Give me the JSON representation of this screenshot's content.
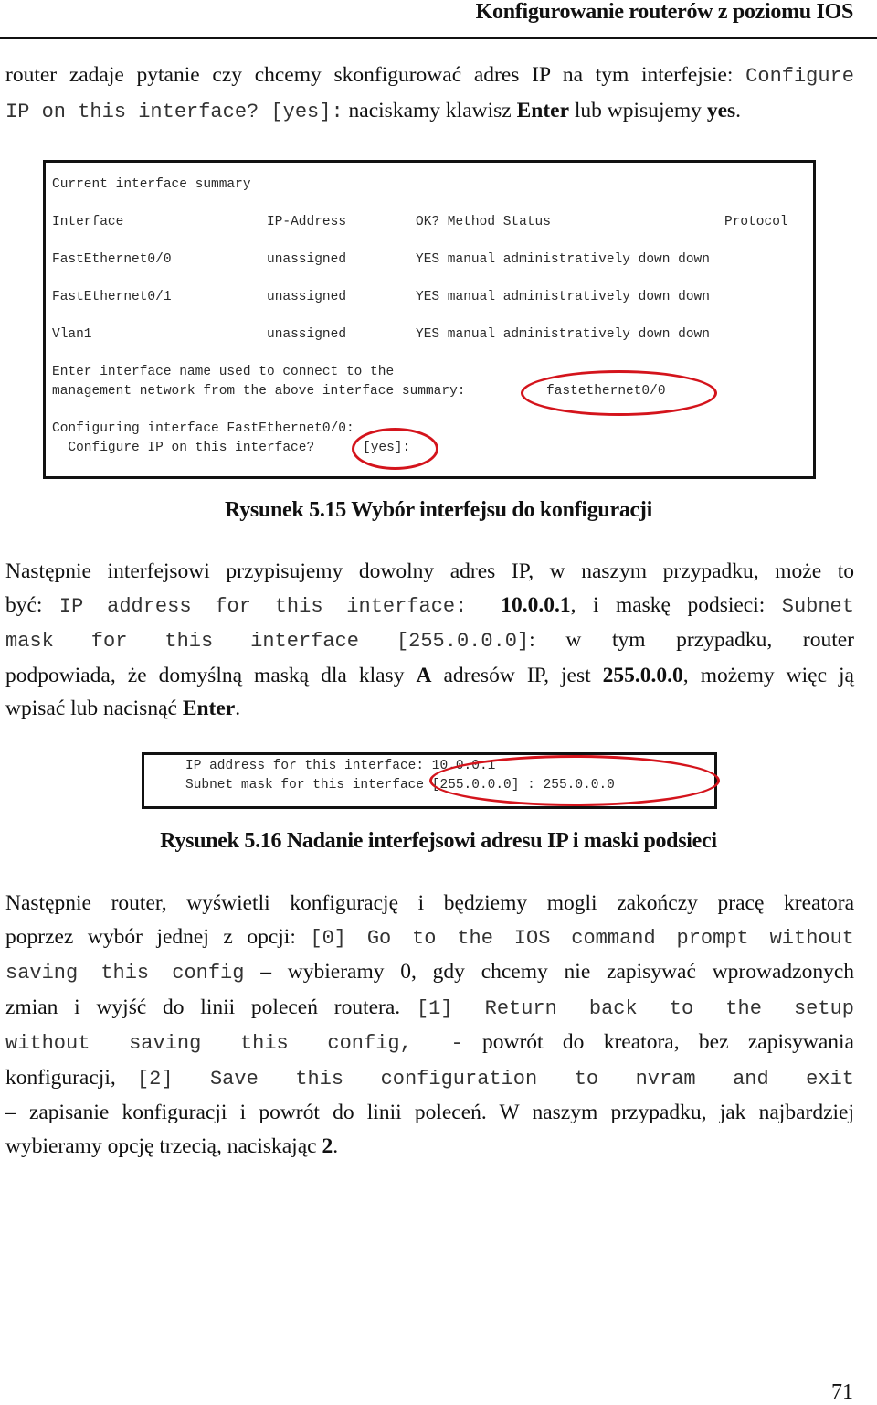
{
  "header": {
    "title": "Konfigurowanie routerów z poziomu IOS"
  },
  "para1": {
    "t1": "router zadaje pytanie czy chcemy skonfigurować adres IP na tym interfejsie: ",
    "m1": "Configure",
    "m2": "IP on this interface? [yes]:",
    "t2": " naciskamy klawisz ",
    "b1": "Enter",
    "t3": " lub wpisujemy ",
    "b2": "yes",
    "t4": "."
  },
  "figure1": {
    "lines": {
      "summary": "Current interface summary",
      "header_interface": "Interface",
      "header_ip": "IP-Address",
      "header_rest": "OK? Method Status",
      "header_protocol": "Protocol",
      "enter1": "Enter interface name used to connect to the",
      "enter2": "management network from the above interface summary:",
      "enter2_answer": "fastethernet0/0",
      "configuring": "Configuring interface FastEthernet0/0:",
      "configure_ip": "  Configure IP on this interface?",
      "configure_ip_default": "[yes]:"
    },
    "rows": [
      {
        "interface": "FastEthernet0/0",
        "ip": "unassigned",
        "rest": "YES manual administratively down down"
      },
      {
        "interface": "FastEthernet0/1",
        "ip": "unassigned",
        "rest": "YES manual administratively down down"
      },
      {
        "interface": "Vlan1",
        "ip": "unassigned",
        "rest": "YES manual administratively down down"
      }
    ],
    "caption": "Rysunek 5.15 Wybór interfejsu do konfiguracji",
    "highlight_color": "#d4141c"
  },
  "para2": {
    "t1": "Następnie interfejsowi przypisujemy dowolny adres IP, w naszym przypadku, może to",
    "t2": "być: ",
    "m1": "IP address for this interface:",
    "b1": "10.0.0.1",
    "t3": ",  i maskę podsieci: ",
    "m2": "Subnet",
    "m3": "mask for this interface [255.0.0.0]",
    "t4": ": w tym przypadku, router",
    "t5": "podpowiada, że domyślną maską dla klasy ",
    "b2": "A",
    "t6": " adresów IP, jest ",
    "b3": "255.0.0.0",
    "t7": ", możemy więc ją",
    "t8": "wpisać lub nacisnąć ",
    "b4": "Enter",
    "t9": "."
  },
  "figure2": {
    "line1": "IP address for this interface: 10.0.0.1",
    "line2": "Subnet mask for this interface [255.0.0.0] : 255.0.0.0",
    "caption": "Rysunek 5.16 Nadanie interfejsowi adresu IP i maski podsieci"
  },
  "para3": {
    "t1": "Następnie router, wyświetli konfigurację i będziemy mogli zakończy pracę kreatora",
    "t2": "poprzez wybór jednej z opcji: ",
    "m1": "[0] Go to the IOS command prompt without",
    "m2": "saving this config",
    "t3": " – wybieramy 0, gdy chcemy nie zapisywać wprowadzonych",
    "t4": "zmian i wyjść do linii poleceń routera. ",
    "m3": "[1]  Return back to the setup",
    "m4": "without saving this config, -",
    "t5": "  powrót do kreatora, bez zapisywania",
    "t6": "konfiguracji, ",
    "m5": "[2]  Save this configuration to nvram and exit",
    "t7": "– zapisanie konfiguracji i powrót do linii poleceń. W naszym przypadku, jak najbardziej",
    "t8": "wybieramy opcję trzecią, naciskając ",
    "b1": "2",
    "t9": "."
  },
  "footer": {
    "page_number": "71"
  }
}
